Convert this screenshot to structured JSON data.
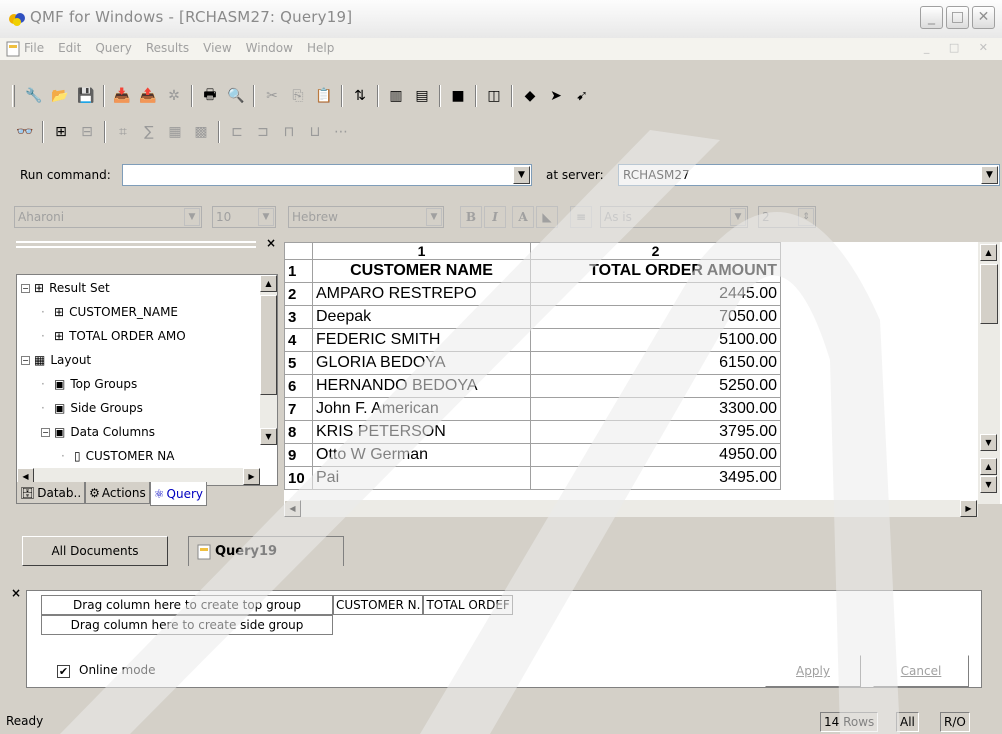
{
  "window": {
    "title": "QMF for Windows - [RCHASM27: Query19]"
  },
  "menu": [
    "File",
    "Edit",
    "Query",
    "Results",
    "View",
    "Window",
    "Help"
  ],
  "run": {
    "label": "Run command:",
    "value": "",
    "server_label": "at server:",
    "server": "RCHASM27"
  },
  "format": {
    "font": "Aharoni",
    "size": "10",
    "script": "Hebrew",
    "bold": "B",
    "italic": "I",
    "align": "As is",
    "width": "2"
  },
  "tree": {
    "items": [
      {
        "label": "Result Set",
        "exp": "−",
        "indent": 0,
        "icon": "sql-icon"
      },
      {
        "label": "CUSTOMER_NAME",
        "exp": "",
        "indent": 1,
        "icon": "sql-icon"
      },
      {
        "label": "TOTAL ORDER AMO",
        "exp": "",
        "indent": 1,
        "icon": "sql-icon"
      },
      {
        "label": "Layout",
        "exp": "−",
        "indent": 0,
        "icon": "table-icon"
      },
      {
        "label": "Top Groups",
        "exp": "",
        "indent": 1,
        "icon": "group-icon"
      },
      {
        "label": "Side Groups",
        "exp": "",
        "indent": 1,
        "icon": "group-icon"
      },
      {
        "label": "Data Columns",
        "exp": "−",
        "indent": 1,
        "icon": "group-icon"
      },
      {
        "label": "CUSTOMER NA",
        "exp": "",
        "indent": 2,
        "icon": "column-icon"
      }
    ],
    "tabs": [
      "Datab..",
      "Actions",
      "Query"
    ]
  },
  "grid": {
    "col_numbers": [
      "1",
      "2"
    ],
    "headers": [
      "CUSTOMER NAME",
      "TOTAL ORDER AMOUNT"
    ],
    "rows": [
      {
        "n": "1",
        "name": "CUSTOMER NAME",
        "amount": "TOTAL ORDER AMOUNT"
      },
      {
        "n": "2",
        "name": "AMPARO RESTREPO",
        "amount": "2445.00"
      },
      {
        "n": "3",
        "name": "Deepak",
        "amount": "7050.00"
      },
      {
        "n": "4",
        "name": "FEDERIC SMITH",
        "amount": "5100.00"
      },
      {
        "n": "5",
        "name": "GLORIA BEDOYA",
        "amount": "6150.00"
      },
      {
        "n": "6",
        "name": "HERNANDO BEDOYA",
        "amount": "5250.00"
      },
      {
        "n": "7",
        "name": "John F. American",
        "amount": "3300.00"
      },
      {
        "n": "8",
        "name": "KRIS PETERSON",
        "amount": "3795.00"
      },
      {
        "n": "9",
        "name": "Otto W German",
        "amount": "4950.00"
      },
      {
        "n": "10",
        "name": "Pai",
        "amount": "3495.00"
      }
    ]
  },
  "doc_tabs": {
    "all": "All Documents",
    "query": "Query19"
  },
  "group_panel": {
    "top": "Drag column here to create top group",
    "side": "Drag column here to create side group",
    "cols": [
      "CUSTOMER N.",
      "TOTAL ORDEF"
    ],
    "online": "Online mode",
    "apply": "Apply",
    "cancel": "Cancel"
  },
  "status": {
    "text": "Ready",
    "rows": "14 Rows",
    "all": "All",
    "mode": "R/O"
  }
}
